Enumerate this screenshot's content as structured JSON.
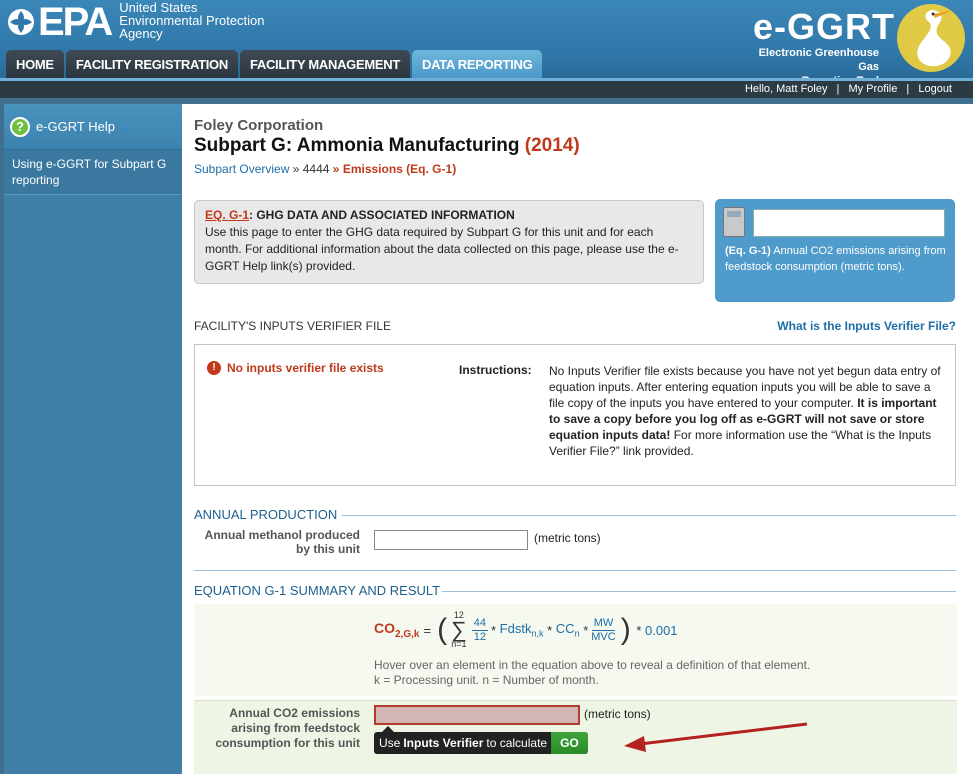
{
  "header": {
    "epa_logo_text": "EPA",
    "agency_name": [
      "United States",
      "Environmental Protection",
      "Agency"
    ],
    "app_title": "e-GGRT",
    "app_subtitle": [
      "Electronic Greenhouse Gas",
      "Reporting Tool"
    ]
  },
  "nav": {
    "tabs": [
      {
        "label": "HOME",
        "active": false
      },
      {
        "label": "FACILITY REGISTRATION",
        "active": false
      },
      {
        "label": "FACILITY MANAGEMENT",
        "active": false
      },
      {
        "label": "DATA REPORTING",
        "active": true
      }
    ]
  },
  "userbar": {
    "greeting": "Hello, Matt Foley",
    "separator": "|",
    "profile_link": "My Profile",
    "logout_link": "Logout"
  },
  "sidebar": {
    "help_title": "e-GGRT Help",
    "help_link": "Using e-GGRT for Subpart G reporting"
  },
  "main": {
    "company": "Foley Corporation",
    "title": "Subpart G: Ammonia Manufacturing",
    "year": "(2014)",
    "breadcrumb": {
      "overview": "Subpart Overview",
      "sep1": "»",
      "unit": "4444",
      "sep2": "»",
      "current": "Emissions (Eq. G-1)"
    },
    "info_box": {
      "eq_link": "EQ. G-1",
      "title_rest": ": GHG DATA AND ASSOCIATED INFORMATION",
      "body": "Use this page to enter the GHG data required by Subpart G for this unit and for each month. For additional information about the data collected on this page, please use the e-GGRT Help link(s) provided."
    },
    "calc_box": {
      "value": "",
      "eq_label": "(Eq. G-1)",
      "description": "Annual CO2 emissions arising from feedstock consumption (metric tons)."
    },
    "verifier": {
      "section_title": "FACILITY'S INPUTS VERIFIER FILE",
      "help_link": "What is the Inputs Verifier File?",
      "status": "No inputs verifier file exists",
      "instructions_label": "Instructions:",
      "instructions_1": "No Inputs Verifier file exists because you have not yet begun data entry of equation inputs.  After entering equation inputs you will be able to save a file copy of the inputs you have entered to your computer.",
      "instructions_bold": "It is important to save a copy before you log off as e-GGRT will not save or store equation inputs data!",
      "instructions_2": "For more information use the “What is the Inputs Verifier File?” link provided."
    },
    "production": {
      "section_title": "ANNUAL PRODUCTION",
      "label": "Annual methanol produced by this unit",
      "value": "",
      "unit": "(metric tons)"
    },
    "equation": {
      "section_title": "EQUATION G-1 SUMMARY AND RESULT",
      "lhs": "CO",
      "lhs_sub": "2,G,k",
      "equals": "=",
      "sum_top": "12",
      "sum_bottom": "n=1",
      "frac1_num": "44",
      "frac1_den": "12",
      "term_fdstk": "Fdstk",
      "term_fdstk_sub": "n,k",
      "term_cc": "CC",
      "term_cc_sub": "n",
      "frac2_num": "MW",
      "frac2_den": "MVC",
      "factor": "0.001",
      "hover_note_1": "Hover over an element in the equation above to reveal a definition of that element.",
      "hover_note_2": "k = Processing unit. n = Number of month."
    },
    "result": {
      "label": "Annual CO2 emissions arising from feedstock consumption for this unit",
      "value": "",
      "unit": "(metric tons)",
      "tooltip_pre": "Use",
      "tooltip_bold": "Inputs Verifier",
      "tooltip_post": "to calculate",
      "go_label": "GO"
    }
  },
  "colors": {
    "header_blue": "#2f77a8",
    "accent_red": "#c0391b",
    "link_blue": "#1e6ea7",
    "go_green": "#2a8a27"
  }
}
